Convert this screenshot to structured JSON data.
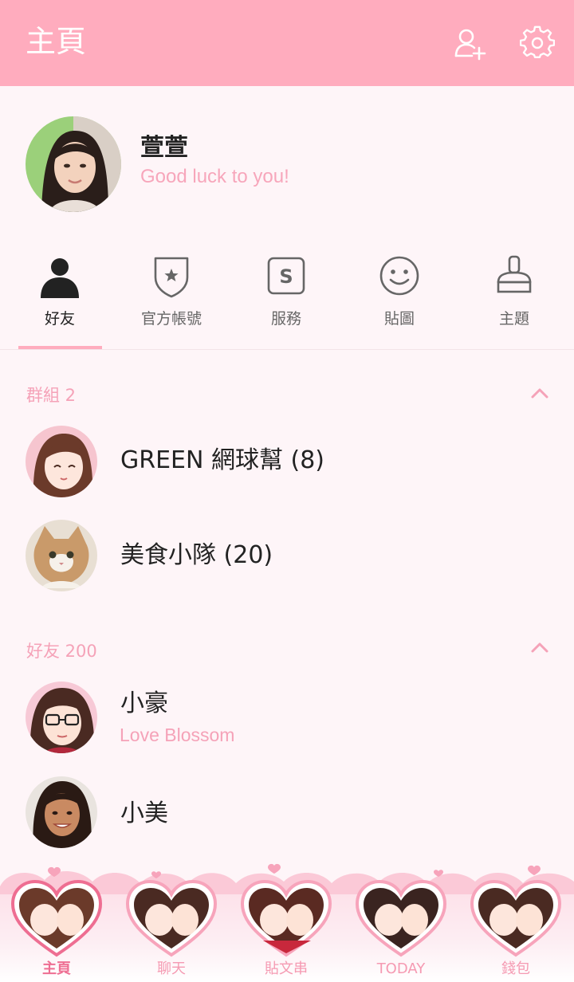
{
  "header": {
    "title": "主頁",
    "add_friend_icon": "add-friend-icon",
    "settings_icon": "gear-icon"
  },
  "profile": {
    "name": "萱萱",
    "status": "Good luck to you!"
  },
  "tabs": [
    {
      "label": "好友",
      "icon": "person-icon",
      "active": true
    },
    {
      "label": "官方帳號",
      "icon": "shield-star-icon",
      "active": false
    },
    {
      "label": "服務",
      "icon": "service-s-icon",
      "active": false
    },
    {
      "label": "貼圖",
      "icon": "smiley-icon",
      "active": false
    },
    {
      "label": "主題",
      "icon": "brush-icon",
      "active": false
    }
  ],
  "groups": {
    "title": "群組 2",
    "items": [
      {
        "name": "GREEN 網球幫 (8)"
      },
      {
        "name": "美食小隊 (20)"
      }
    ]
  },
  "friends": {
    "title": "好友 200",
    "items": [
      {
        "name": "小豪",
        "status": "Love Blossom"
      },
      {
        "name": "小美"
      }
    ]
  },
  "bottom_nav": [
    {
      "label": "主頁",
      "active": true
    },
    {
      "label": "聊天",
      "active": false
    },
    {
      "label": "貼文串",
      "active": false
    },
    {
      "label": "TODAY",
      "active": false
    },
    {
      "label": "錢包",
      "active": false
    }
  ],
  "colors": {
    "accent": "#ffacbe",
    "accent_text": "#f5a2b8",
    "background": "#fef5f8"
  }
}
